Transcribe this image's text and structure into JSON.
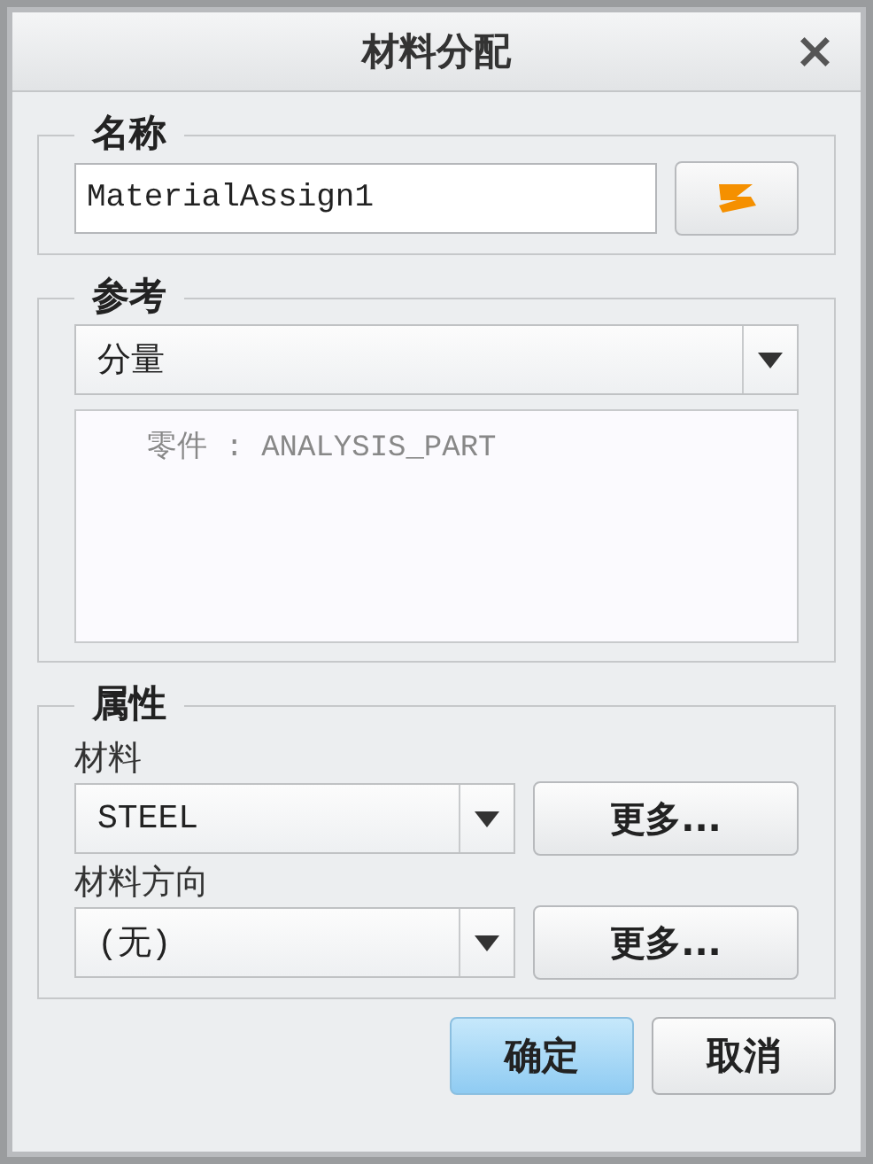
{
  "window": {
    "title": "材料分配",
    "close": "×"
  },
  "name_group": {
    "legend": "名称",
    "value": "MaterialAssign1"
  },
  "reference_group": {
    "legend": "参考",
    "dropdown": "分量",
    "items": [
      "零件 : ANALYSIS_PART"
    ]
  },
  "properties_group": {
    "legend": "属性",
    "fields": [
      {
        "label": "材料",
        "value": "STEEL",
        "button": "更多..."
      },
      {
        "label": "材料方向",
        "value": "(无)",
        "button": "更多..."
      }
    ]
  },
  "buttons": [
    {
      "label": "确定",
      "default": true
    },
    {
      "label": "取消",
      "default": false
    }
  ]
}
